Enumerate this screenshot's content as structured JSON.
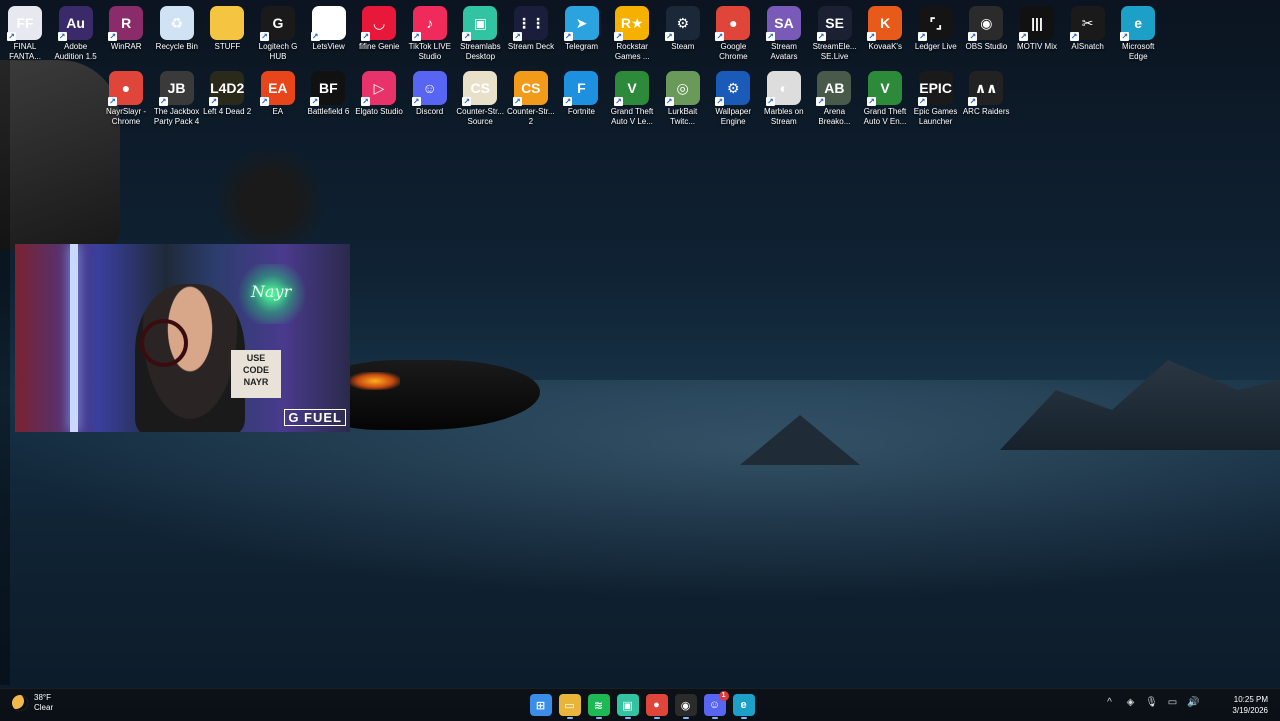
{
  "desktop": {
    "icons_row1": [
      {
        "label": "FINAL\nFANTA...",
        "icon": "final-fantasy-icon",
        "color": "#e8e8f0",
        "glyph": "FF"
      },
      {
        "label": "Adobe\nAudition 1.5",
        "icon": "adobe-audition-icon",
        "color": "#3a2a6a",
        "glyph": "Au"
      },
      {
        "label": "WinRAR",
        "icon": "winrar-icon",
        "color": "#8a2c6a",
        "glyph": "R"
      },
      {
        "label": "Recycle Bin",
        "icon": "recycle-bin-icon",
        "color": "#cfe3f5",
        "glyph": "♻"
      },
      {
        "label": "STUFF",
        "icon": "folder-icon",
        "color": "#f5c542",
        "glyph": ""
      },
      {
        "label": "Logitech G\nHUB",
        "icon": "logitech-ghub-icon",
        "color": "#1a1a1a",
        "glyph": "G"
      },
      {
        "label": "LetsView",
        "icon": "letsview-icon",
        "color": "#ffffff",
        "glyph": "◇"
      },
      {
        "label": "fifine Genie",
        "icon": "fifine-genie-icon",
        "color": "#e8183a",
        "glyph": "◡"
      },
      {
        "label": "TikTok LIVE\nStudio",
        "icon": "tiktok-live-icon",
        "color": "#f02a5a",
        "glyph": "♪"
      },
      {
        "label": "Streamlabs\nDesktop",
        "icon": "streamlabs-icon",
        "color": "#31c3a2",
        "glyph": "▣"
      },
      {
        "label": "Stream Deck",
        "icon": "stream-deck-icon",
        "color": "#1a1e3a",
        "glyph": "⋮⋮"
      },
      {
        "label": "Telegram",
        "icon": "telegram-icon",
        "color": "#2aa3df",
        "glyph": "➤"
      },
      {
        "label": "Rockstar\nGames ...",
        "icon": "rockstar-games-icon",
        "color": "#f6b100",
        "glyph": "R★"
      },
      {
        "label": "Steam",
        "icon": "steam-icon",
        "color": "#1b2838",
        "glyph": "⚙"
      },
      {
        "label": "Google\nChrome",
        "icon": "chrome-icon",
        "color": "#e0453a",
        "glyph": "●"
      },
      {
        "label": "Stream\nAvatars",
        "icon": "stream-avatars-icon",
        "color": "#7a5ab8",
        "glyph": "SA"
      },
      {
        "label": "StreamEle...\nSE.Live",
        "icon": "streamelements-icon",
        "color": "#1c2033",
        "glyph": "SE"
      },
      {
        "label": "KovaaK's",
        "icon": "kovaaks-icon",
        "color": "#e85a1a",
        "glyph": "K"
      },
      {
        "label": "Ledger Live",
        "icon": "ledger-live-icon",
        "color": "#141414",
        "glyph": "⌜⌟"
      },
      {
        "label": "OBS Studio",
        "icon": "obs-studio-icon",
        "color": "#2b2b2b",
        "glyph": "◉"
      },
      {
        "label": "MOTIV Mix",
        "icon": "motiv-mix-icon",
        "color": "#111111",
        "glyph": "|||"
      },
      {
        "label": "AISnatch",
        "icon": "aisnatch-icon",
        "color": "#1a1a1a",
        "glyph": "✂"
      },
      {
        "label": "Microsoft\nEdge",
        "icon": "edge-icon",
        "color": "#1da0c8",
        "glyph": "e"
      }
    ],
    "icons_row2": [
      {
        "label": "NayrSlayr -\nChrome",
        "icon": "chrome-profile-icon",
        "color": "#e0453a",
        "glyph": "●"
      },
      {
        "label": "The Jackbox\nParty Pack 4",
        "icon": "jackbox-icon",
        "color": "#3a3a3a",
        "glyph": "JB"
      },
      {
        "label": "Left 4 Dead 2",
        "icon": "left4dead2-icon",
        "color": "#2a2a1a",
        "glyph": "L4D2"
      },
      {
        "label": "EA",
        "icon": "ea-icon",
        "color": "#e8451a",
        "glyph": "EA"
      },
      {
        "label": "Battlefield 6",
        "icon": "battlefield6-icon",
        "color": "#111111",
        "glyph": "BF"
      },
      {
        "label": "Elgato Studio",
        "icon": "elgato-studio-icon",
        "color": "#e8336a",
        "glyph": "▷"
      },
      {
        "label": "Discord",
        "icon": "discord-icon",
        "color": "#5865f2",
        "glyph": "☺"
      },
      {
        "label": "Counter-Str...\nSource",
        "icon": "counter-strike-source-icon",
        "color": "#e8e0c8",
        "glyph": "CS"
      },
      {
        "label": "Counter-Str...\n2",
        "icon": "counter-strike-2-icon",
        "color": "#f29a1a",
        "glyph": "CS"
      },
      {
        "label": "Fortnite",
        "icon": "fortnite-icon",
        "color": "#1e90e0",
        "glyph": "F"
      },
      {
        "label": "Grand Theft\nAuto V Le...",
        "icon": "gta-v-legacy-icon",
        "color": "#2c8a3a",
        "glyph": "V"
      },
      {
        "label": "LurkBait\nTwitc...",
        "icon": "lurkbait-icon",
        "color": "#6a9a5a",
        "glyph": "◎"
      },
      {
        "label": "Wallpaper\nEngine",
        "icon": "wallpaper-engine-icon",
        "color": "#1a5ab8",
        "glyph": "⚙"
      },
      {
        "label": "Marbles on\nStream",
        "icon": "marbles-on-stream-icon",
        "color": "#dddddd",
        "glyph": "◐"
      },
      {
        "label": "Arena\nBreako...",
        "icon": "arena-breakout-icon",
        "color": "#4a5a4a",
        "glyph": "AB"
      },
      {
        "label": "Grand Theft\nAuto V En...",
        "icon": "gta-v-enhanced-icon",
        "color": "#2c8a3a",
        "glyph": "V"
      },
      {
        "label": "Epic Games\nLauncher",
        "icon": "epic-games-icon",
        "color": "#1a1a1a",
        "glyph": "EPIC"
      },
      {
        "label": "ARC Raiders",
        "icon": "arc-raiders-icon",
        "color": "#222222",
        "glyph": "∧∧"
      }
    ]
  },
  "webcam": {
    "sign_text": "USE\nCODE\nNAYR",
    "neon_text": "Nayr",
    "logo_text": "G FUEL"
  },
  "taskbar": {
    "weather": {
      "temp": "38°F",
      "condition": "Clear"
    },
    "apps": [
      {
        "name": "start-button",
        "icon": "windows-start-icon",
        "color": "#3a8ee8",
        "glyph": "⊞"
      },
      {
        "name": "file-explorer",
        "icon": "file-explorer-icon",
        "color": "#e8b43a",
        "glyph": "▭"
      },
      {
        "name": "spotify",
        "icon": "spotify-icon",
        "color": "#1db954",
        "glyph": "≋"
      },
      {
        "name": "streamlabs",
        "icon": "streamlabs-icon",
        "color": "#31c3a2",
        "glyph": "▣"
      },
      {
        "name": "chrome",
        "icon": "chrome-icon",
        "color": "#e0453a",
        "glyph": "●"
      },
      {
        "name": "obs-studio",
        "icon": "obs-studio-icon",
        "color": "#2b2b2b",
        "glyph": "◉"
      },
      {
        "name": "discord",
        "icon": "discord-icon",
        "color": "#5865f2",
        "glyph": "☺",
        "badge": "1"
      },
      {
        "name": "edge",
        "icon": "edge-icon",
        "color": "#1da0c8",
        "glyph": "e"
      }
    ],
    "tray": [
      {
        "icon": "chevron-up-icon",
        "glyph": "^"
      },
      {
        "icon": "security-shield-icon",
        "glyph": "◈"
      },
      {
        "icon": "microphone-icon",
        "glyph": "🎙"
      },
      {
        "icon": "network-icon",
        "glyph": "▭"
      },
      {
        "icon": "volume-icon",
        "glyph": "🔊"
      }
    ],
    "clock": {
      "time": "10:25 PM",
      "date": "3/19/2026"
    }
  }
}
